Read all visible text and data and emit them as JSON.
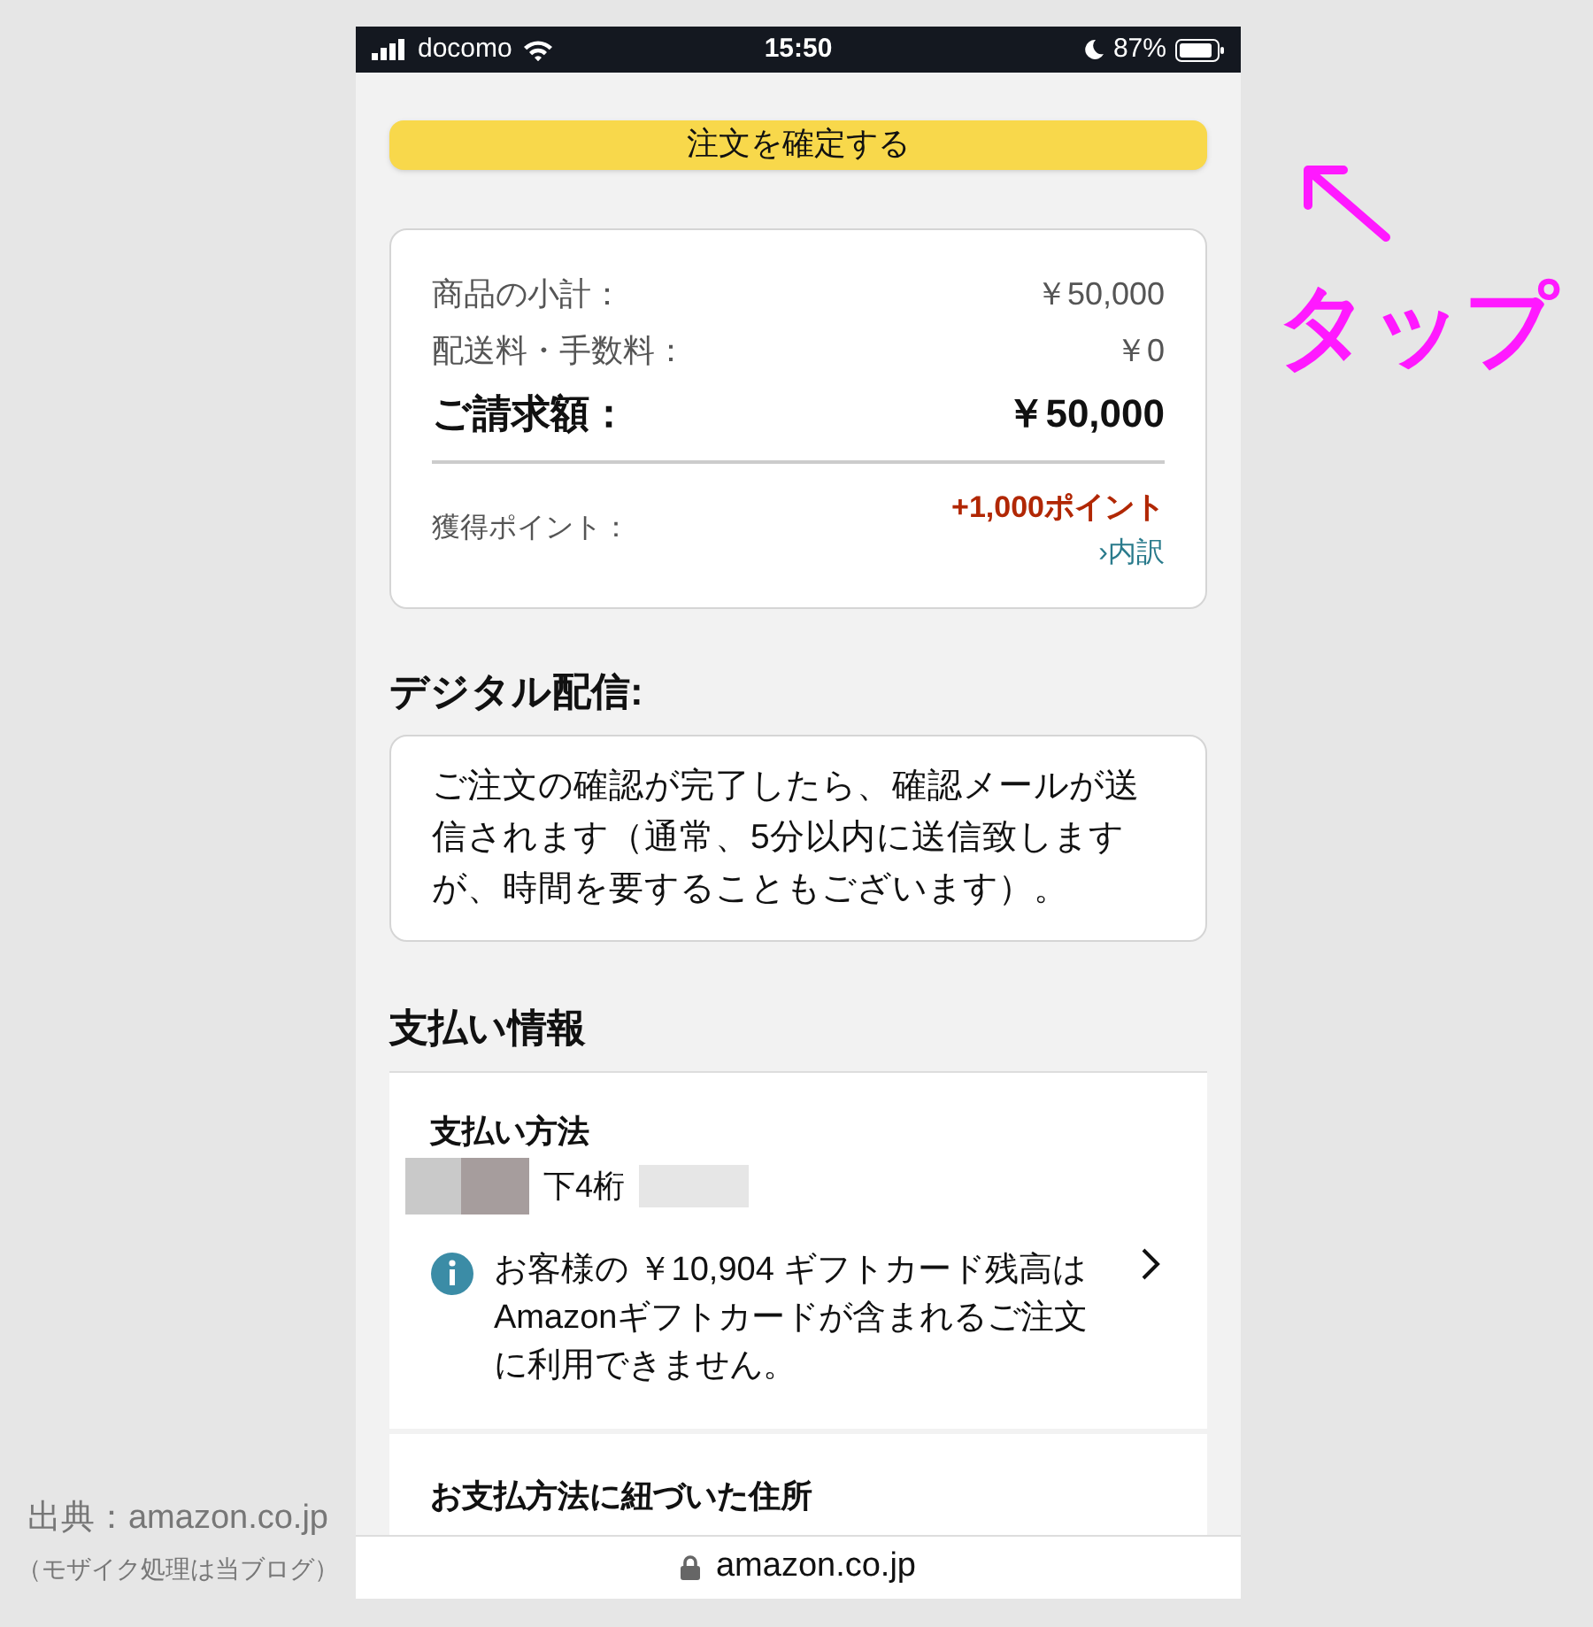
{
  "status_bar": {
    "carrier": "docomo",
    "time": "15:50",
    "battery": "87%"
  },
  "place_order_button": "注文を確定する",
  "summary": {
    "rows": [
      {
        "label": "商品の小計：",
        "value": "￥50,000"
      },
      {
        "label": "配送料・手数料：",
        "value": "￥0"
      }
    ],
    "total": {
      "label": "ご請求額：",
      "value": "￥50,000"
    },
    "points": {
      "label": "獲得ポイント：",
      "value": "+1,000ポイント",
      "link": "›内訳"
    }
  },
  "digital": {
    "heading": "デジタル配信:",
    "text": "ご注文の確認が完了したら、確認メールが送信されます（通常、5分以内に送信致しますが、時間を要することもございます）。"
  },
  "payment": {
    "heading": "支払い情報",
    "method_title": "支払い方法",
    "card_digits": "下4桁",
    "notice": "お客様の ￥10,904 ギフトカード残高はAmazonギフトカードが含まれるご注文に利用できません。",
    "address_title": "お支払方法に紐づいた住所"
  },
  "url_bar": "amazon.co.jp",
  "annotation": "タップ",
  "credit": {
    "source": "出典：amazon.co.jp",
    "note": "（モザイク処理は当ブログ）"
  }
}
